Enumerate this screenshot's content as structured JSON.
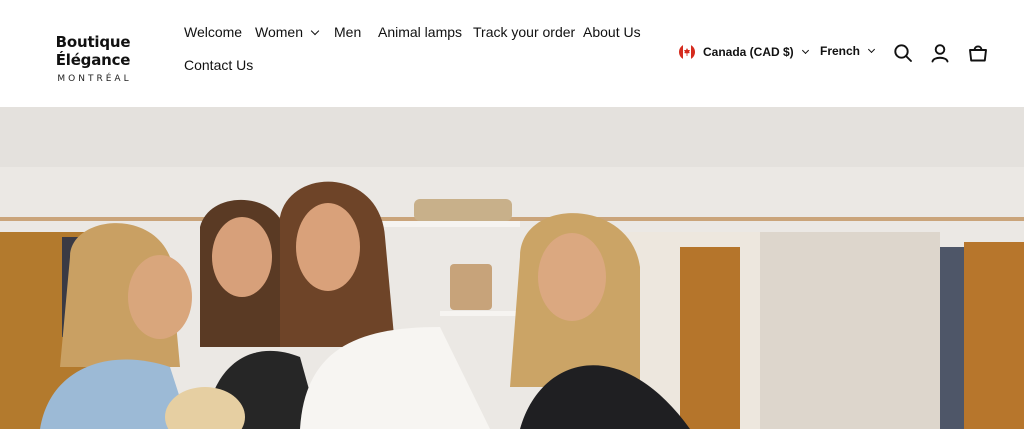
{
  "brand": {
    "name": "Boutique Élégance",
    "city": "MONTRÉAL"
  },
  "nav": {
    "items": [
      {
        "label": "Welcome",
        "has_dropdown": false
      },
      {
        "label": "Women",
        "has_dropdown": true
      },
      {
        "label": "Men",
        "has_dropdown": false
      },
      {
        "label": "Animal lamps",
        "has_dropdown": false
      },
      {
        "label": "Track your order",
        "has_dropdown": false
      },
      {
        "label": "About Us",
        "has_dropdown": false
      },
      {
        "label": "Contact Us",
        "has_dropdown": false
      }
    ]
  },
  "locale": {
    "country": "Canada (CAD $)",
    "country_flag_icon": "canada-flag-icon",
    "language": "French"
  },
  "tools": {
    "search_icon": "search-icon",
    "account_icon": "user-icon",
    "cart_icon": "shopping-bag-icon"
  },
  "hero": {
    "image_subject": "four smiling women in a clothing boutique with garment racks",
    "colors": {
      "wall": "#e9e6e3",
      "shelf": "#f4f2ef",
      "rail": "#caa47a",
      "mustard": "#b07a2c",
      "cream": "#ece4d8"
    }
  }
}
